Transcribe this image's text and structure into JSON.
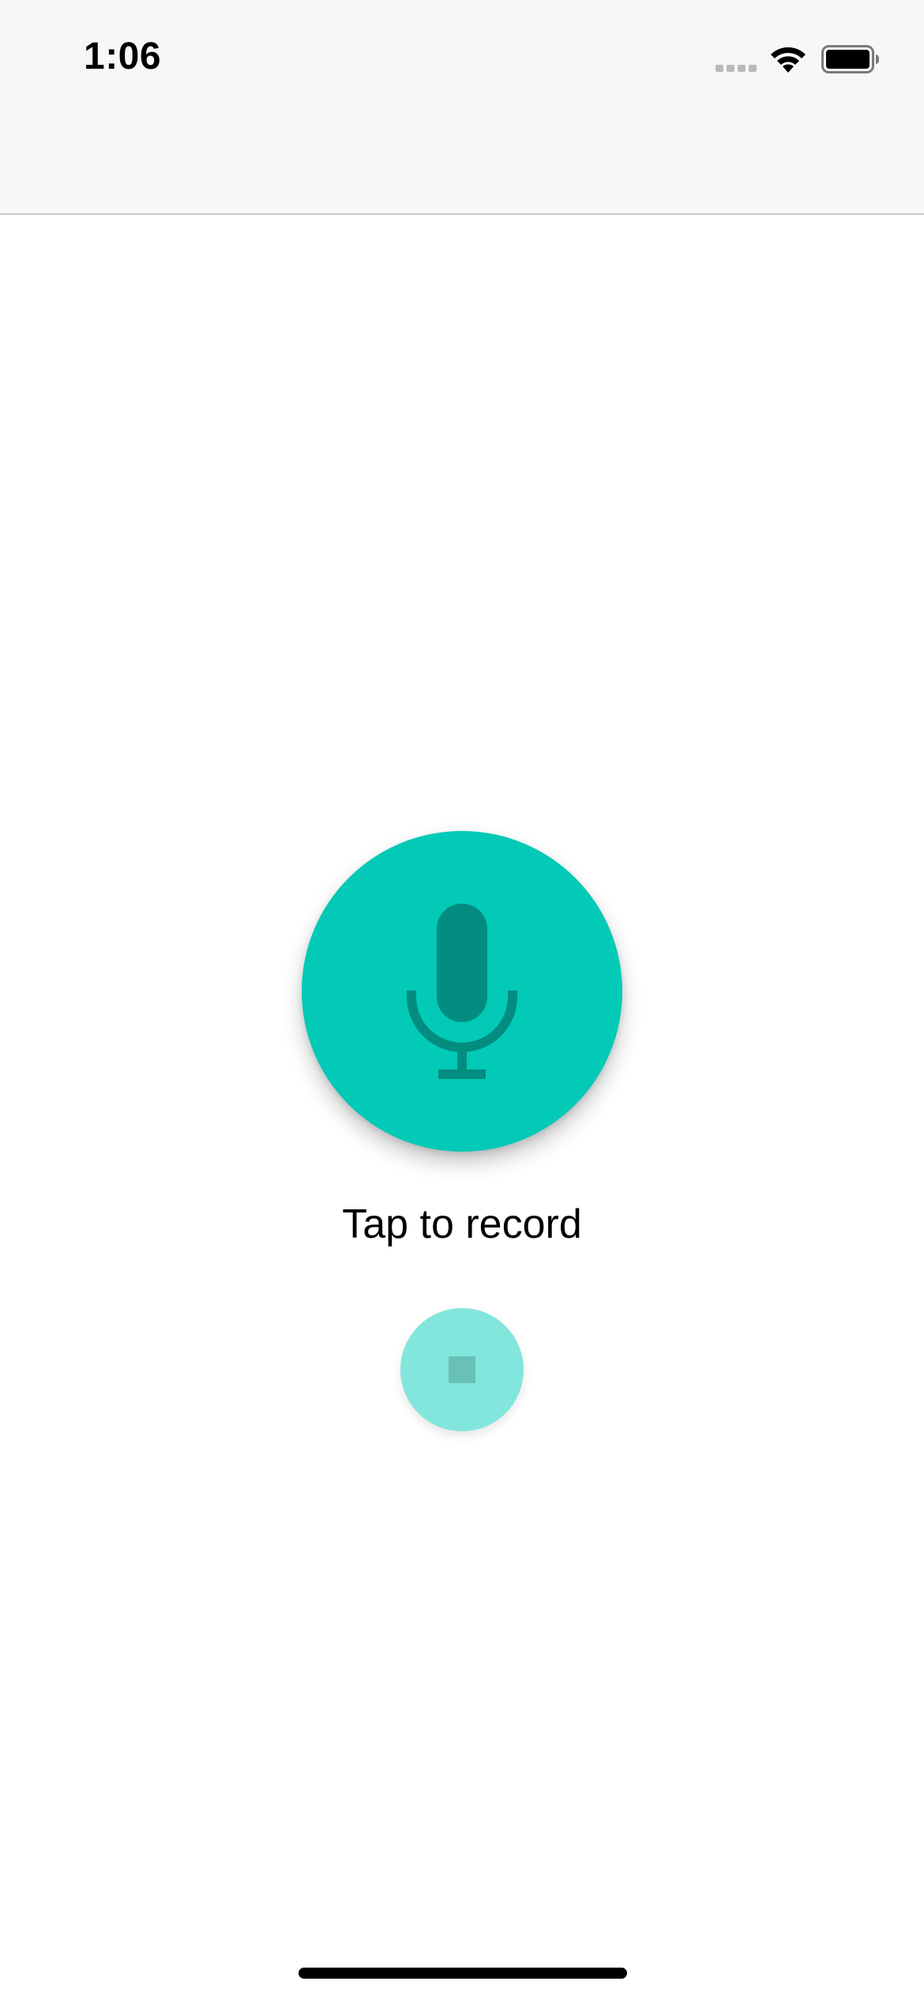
{
  "status_bar": {
    "time": "1:06"
  },
  "recorder": {
    "prompt": "Tap to record"
  },
  "colors": {
    "accent": "#03c9b7",
    "mic_icon": "#038c80",
    "stop_button": "#82e6dc"
  },
  "icons": {
    "mic": "microphone-icon",
    "stop": "stop-icon",
    "wifi": "wifi-icon",
    "battery": "battery-icon",
    "signal": "signal-icon"
  }
}
